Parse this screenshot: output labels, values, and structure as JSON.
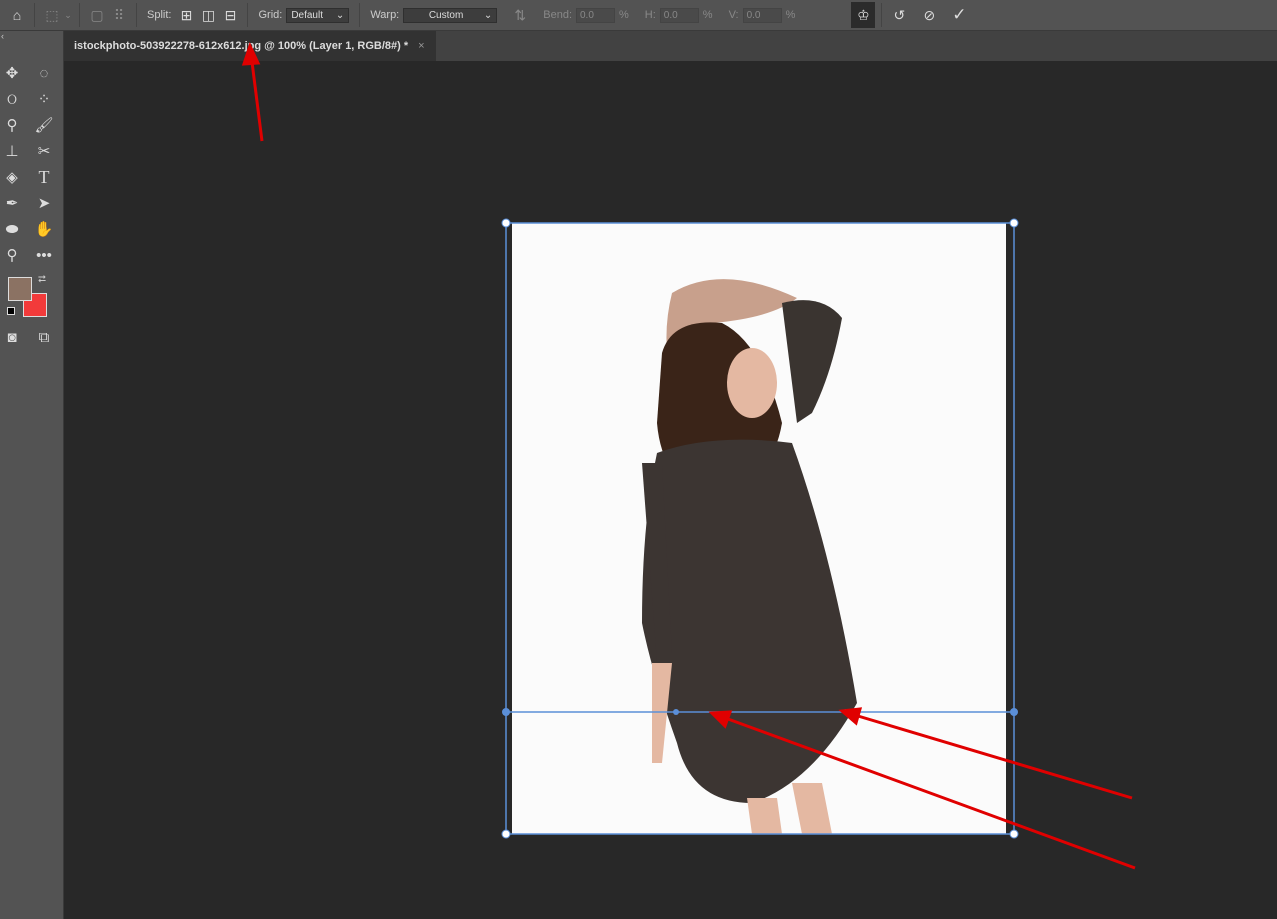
{
  "options_bar": {
    "split_label": "Split:",
    "grid_label": "Grid:",
    "grid_value": "Default",
    "warp_label": "Warp:",
    "warp_value": "Custom",
    "bend_label": "Bend:",
    "bend_value": "0.0",
    "bend_unit": "%",
    "h_label": "H:",
    "h_value": "0.0",
    "h_unit": "%",
    "v_label": "V:",
    "v_value": "0.0",
    "v_unit": "%"
  },
  "document_tab": {
    "title": "istockphoto-503922278-612x612.jpg @ 100% (Layer 1, RGB/8#) *",
    "close": "×"
  },
  "tools": [
    "move",
    "elliptical-marquee",
    "lasso",
    "quick-selection",
    "eyedropper",
    "brush",
    "clone-stamp",
    "eraser",
    "paint-bucket",
    "type",
    "pen",
    "path-selection",
    "ellipse",
    "hand",
    "zoom",
    "more"
  ],
  "colors": {
    "foreground": "#8b7263",
    "background": "#f23a3a",
    "selection": "#5b8fd8",
    "annotation": "#e00000"
  }
}
